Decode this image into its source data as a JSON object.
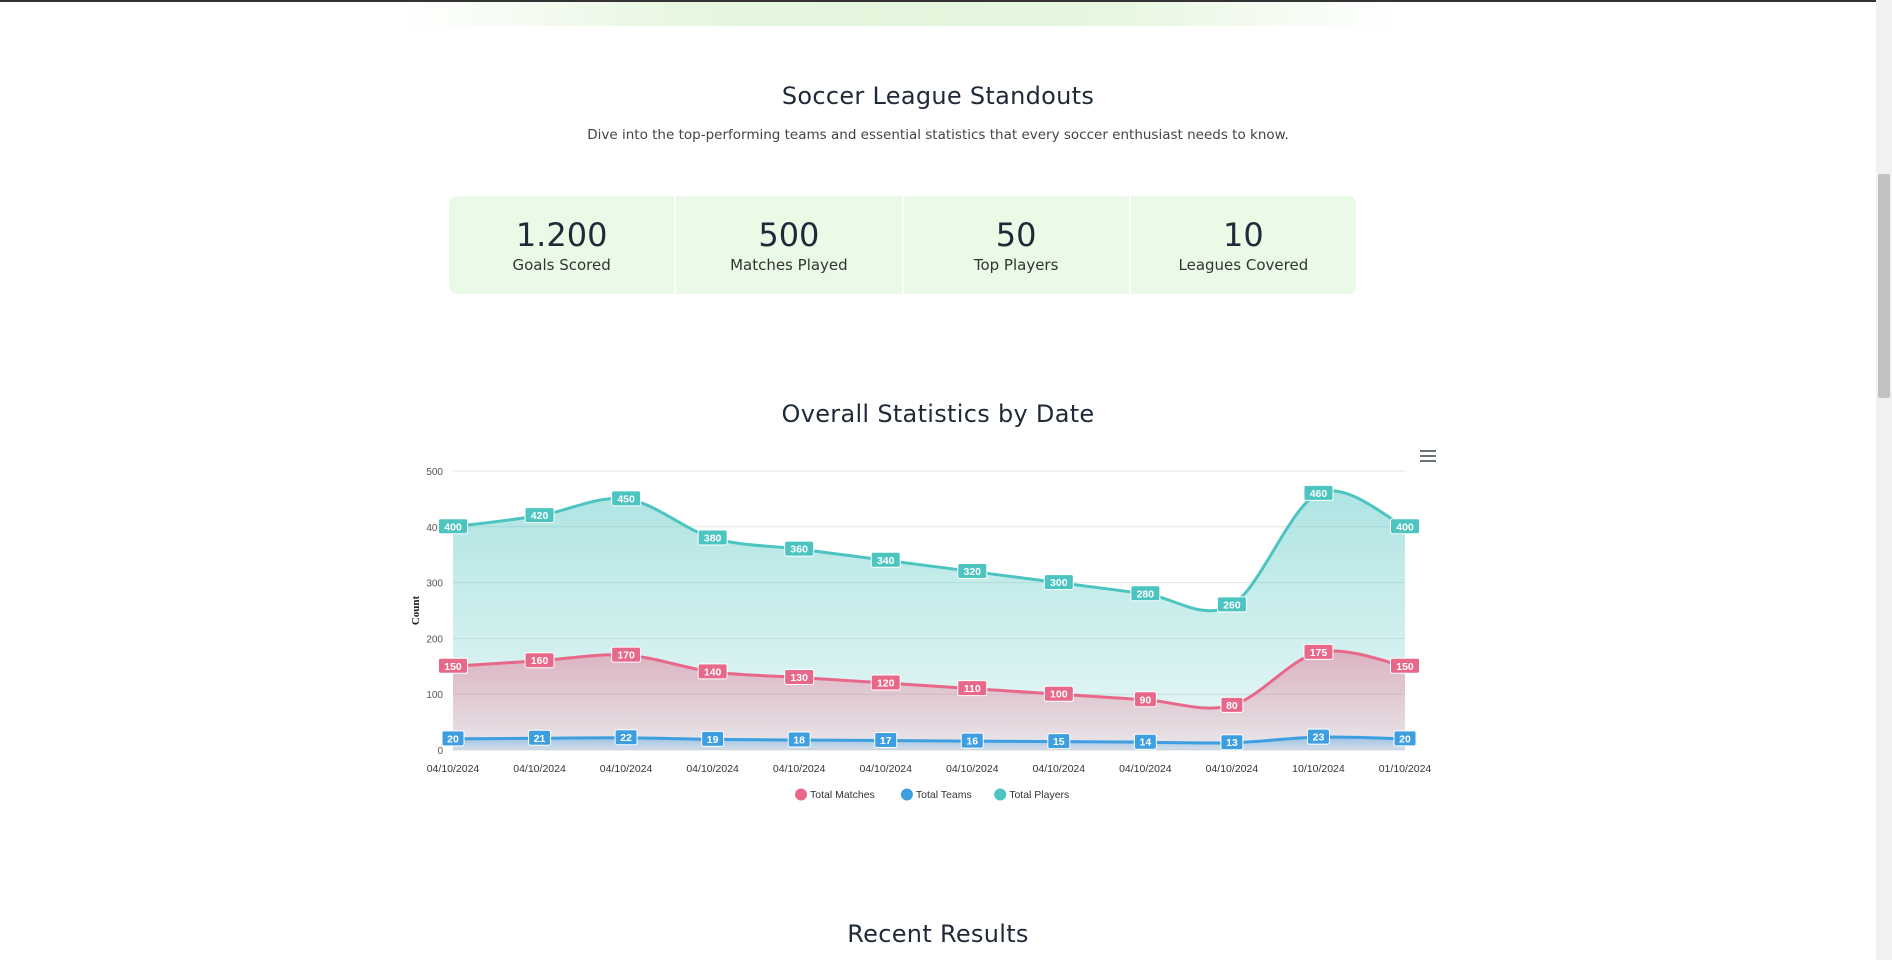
{
  "standouts": {
    "title": "Soccer League Standouts",
    "subtitle": "Dive into the top-performing teams and essential statistics that every soccer enthusiast needs to know.",
    "stats": [
      {
        "value": "1.200",
        "label": "Goals Scored"
      },
      {
        "value": "500",
        "label": "Matches Played"
      },
      {
        "value": "50",
        "label": "Top Players"
      },
      {
        "value": "10",
        "label": "Leagues Covered"
      }
    ]
  },
  "overall": {
    "title": "Overall Statistics by Date",
    "menu_icon": "hamburger-menu-icon"
  },
  "recent": {
    "title": "Recent Results"
  },
  "chart_data": {
    "type": "area",
    "title": "",
    "xlabel": "",
    "ylabel": "Count",
    "ylim": [
      0,
      500
    ],
    "yticks": [
      0,
      100,
      200,
      300,
      400,
      500
    ],
    "categories": [
      "04/10/2024",
      "04/10/2024",
      "04/10/2024",
      "04/10/2024",
      "04/10/2024",
      "04/10/2024",
      "04/10/2024",
      "04/10/2024",
      "04/10/2024",
      "04/10/2024",
      "10/10/2024",
      "01/10/2024"
    ],
    "series": [
      {
        "name": "Total Matches",
        "color": "#e8688a",
        "values": [
          150,
          160,
          170,
          140,
          130,
          120,
          110,
          100,
          90,
          80,
          175,
          150
        ]
      },
      {
        "name": "Total Teams",
        "color": "#3d9fe0",
        "values": [
          20,
          21,
          22,
          19,
          18,
          17,
          16,
          15,
          14,
          13,
          23,
          20
        ]
      },
      {
        "name": "Total Players",
        "color": "#4cc4c0",
        "values": [
          400,
          420,
          450,
          380,
          360,
          340,
          320,
          300,
          280,
          260,
          460,
          400
        ]
      }
    ],
    "legend_position": "bottom",
    "grid": true
  }
}
